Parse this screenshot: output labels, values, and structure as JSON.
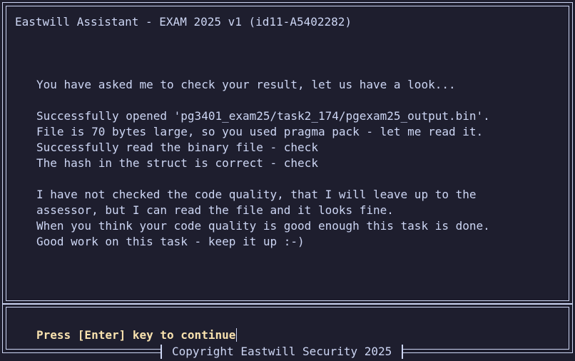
{
  "window": {
    "title": "Eastwill Assistant - EXAM 2025 v1 (id11-A5402282)"
  },
  "message": {
    "lines": [
      "You have asked me to check your result, let us have a look...",
      "",
      "Successfully opened 'pg3401_exam25/task2_174/pgexam25_output.bin'.",
      "File is 70 bytes large, so you used pragma pack - let me read it.",
      "Successfully read the binary file - check",
      "The hash in the struct is correct - check",
      "",
      "I have not checked the code quality, that I will leave up to the",
      "assessor, but I can read the file and it looks fine.",
      "When you think your code quality is good enough this task is done.",
      "Good work on this task - keep it up :-)"
    ]
  },
  "prompt": {
    "text": "Press [Enter] key to continue"
  },
  "footer": {
    "copyright": "Copyright Eastwill Security 2025"
  },
  "colors": {
    "background": "#1e1e2e",
    "foreground": "#cdd6f4",
    "prompt": "#f9e2af"
  }
}
